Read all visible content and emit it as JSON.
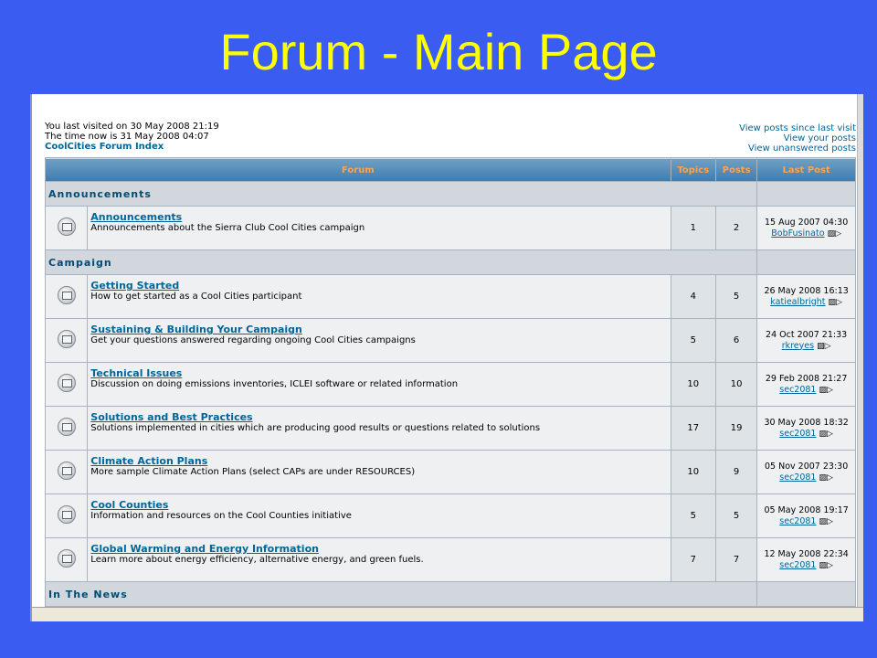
{
  "slide_title": "Forum - Main Page",
  "visit": {
    "last_visited": "You last visited on 30 May 2008 21:19",
    "time_now": "The time now is 31 May 2008 04:07",
    "index_link": "CoolCities Forum Index"
  },
  "quick_links": [
    "View posts since last visit",
    "View your posts",
    "View unanswered posts"
  ],
  "table_headers": {
    "forum": "Forum",
    "topics": "Topics",
    "posts": "Posts",
    "last_post": "Last Post"
  },
  "categories": [
    {
      "name": "Announcements",
      "forums": [
        {
          "title": "Announcements",
          "desc": "Announcements about the Sierra Club Cool Cities campaign",
          "topics": "1",
          "posts": "2",
          "last_date": "15 Aug 2007 04:30",
          "last_user": "BobFusinato"
        }
      ]
    },
    {
      "name": "Campaign",
      "forums": [
        {
          "title": "Getting Started",
          "desc": "How to get started as a Cool Cities participant",
          "topics": "4",
          "posts": "5",
          "last_date": "26 May 2008 16:13",
          "last_user": "katiealbright"
        },
        {
          "title": "Sustaining & Building Your Campaign",
          "desc": "Get your questions answered regarding ongoing Cool Cities campaigns",
          "topics": "5",
          "posts": "6",
          "last_date": "24 Oct 2007 21:33",
          "last_user": "rkreyes"
        },
        {
          "title": "Technical Issues",
          "desc": "Discussion on doing emissions inventories, ICLEI software or related information",
          "topics": "10",
          "posts": "10",
          "last_date": "29 Feb 2008 21:27",
          "last_user": "sec2081"
        },
        {
          "title": "Solutions and Best Practices",
          "desc": "Solutions implemented in cities which are producing good results or questions related to solutions",
          "topics": "17",
          "posts": "19",
          "last_date": "30 May 2008 18:32",
          "last_user": "sec2081"
        },
        {
          "title": "Climate Action Plans",
          "desc": "More sample Climate Action Plans (select CAPs are under RESOURCES)",
          "topics": "10",
          "posts": "9",
          "last_date": "05 Nov 2007 23:30",
          "last_user": "sec2081"
        },
        {
          "title": "Cool Counties",
          "desc": "Information and resources on the Cool Counties initiative",
          "topics": "5",
          "posts": "5",
          "last_date": "05 May 2008 19:17",
          "last_user": "sec2081"
        },
        {
          "title": "Global Warming and Energy Information",
          "desc": "Learn more about energy efficiency, alternative energy, and green fuels.",
          "topics": "7",
          "posts": "7",
          "last_date": "12 May 2008 22:34",
          "last_user": "sec2081"
        }
      ]
    },
    {
      "name": "In The News",
      "forums": []
    }
  ],
  "icons": {
    "forum_icon": "folder-icon",
    "goto_icon": "goto-last-post-icon"
  },
  "colors": {
    "slide_bg": "#3a5cf0",
    "title": "#ffff00",
    "link": "#006699",
    "header_text": "#ffa34f"
  }
}
